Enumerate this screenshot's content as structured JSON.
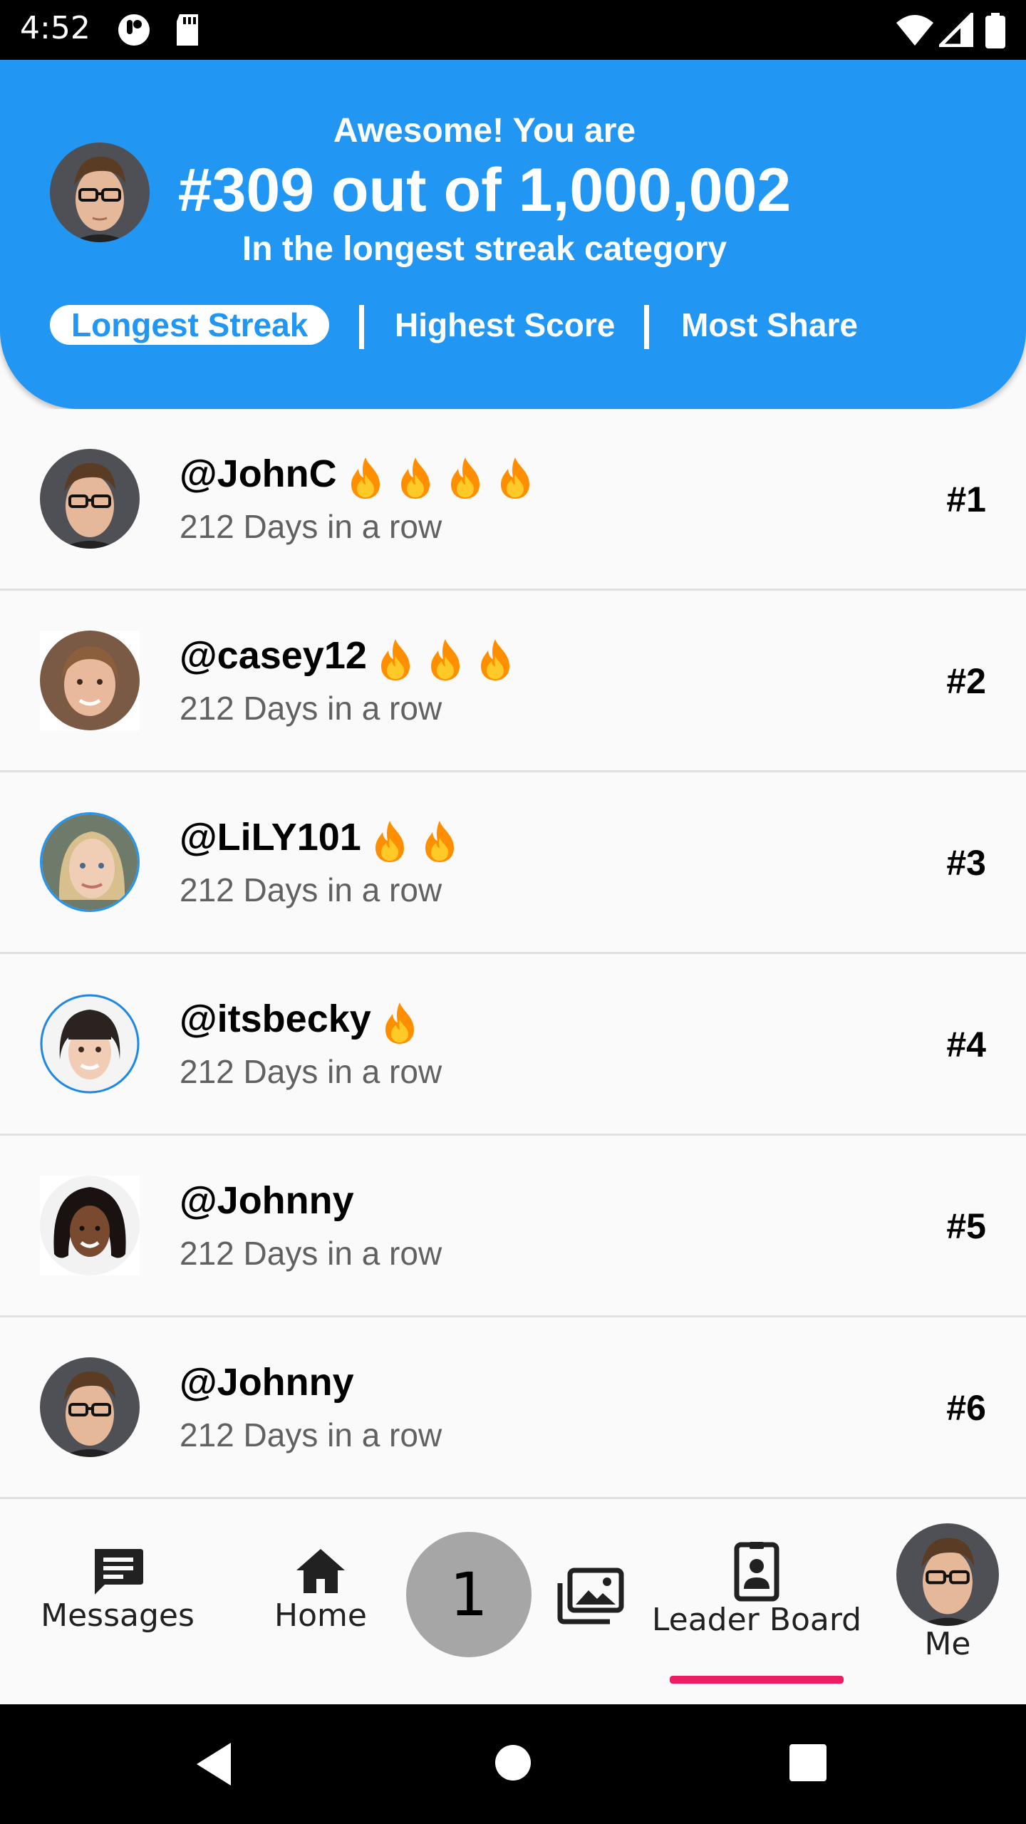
{
  "status_bar": {
    "time": "4:52"
  },
  "header": {
    "line1": "Awesome! You are",
    "line2": "#309 out of 1,000,002",
    "line3": "In the longest streak category",
    "tabs": [
      {
        "label": "Longest Streak",
        "active": true
      },
      {
        "label": "Highest Score",
        "active": false
      },
      {
        "label": "Most Share",
        "active": false
      }
    ]
  },
  "leaderboard": [
    {
      "name": "@JohnC",
      "subtitle": "212 Days in a row",
      "rank": "#1",
      "flames": 4,
      "avatar": "man-glasses-avatar"
    },
    {
      "name": "@casey12",
      "subtitle": "212 Days in a row",
      "rank": "#2",
      "flames": 3,
      "avatar": "woman-avatar"
    },
    {
      "name": "@LiLY101",
      "subtitle": "212 Days in a row",
      "rank": "#3",
      "flames": 2,
      "avatar": "woman-blonde-avatar"
    },
    {
      "name": "@itsbecky",
      "subtitle": "212 Days in a row",
      "rank": "#4",
      "flames": 1,
      "avatar": "woman-bangs-avatar"
    },
    {
      "name": "@Johnny",
      "subtitle": "212 Days in a row",
      "rank": "#5",
      "flames": 0,
      "avatar": "woman-curly-avatar"
    },
    {
      "name": "@Johnny",
      "subtitle": "212 Days in a row",
      "rank": "#6",
      "flames": 0,
      "avatar": "man-glasses-avatar"
    }
  ],
  "bottom_nav": {
    "messages_label": "Messages",
    "home_label": "Home",
    "center_count": "1",
    "leaderboard_label": "Leader Board",
    "me_label": "Me",
    "active": "Leader Board"
  },
  "colors": {
    "header_blue": "#2196f3",
    "accent_pink": "#e91e63",
    "flame_orange": "#ff8f00",
    "subtitle_gray": "#616161"
  }
}
